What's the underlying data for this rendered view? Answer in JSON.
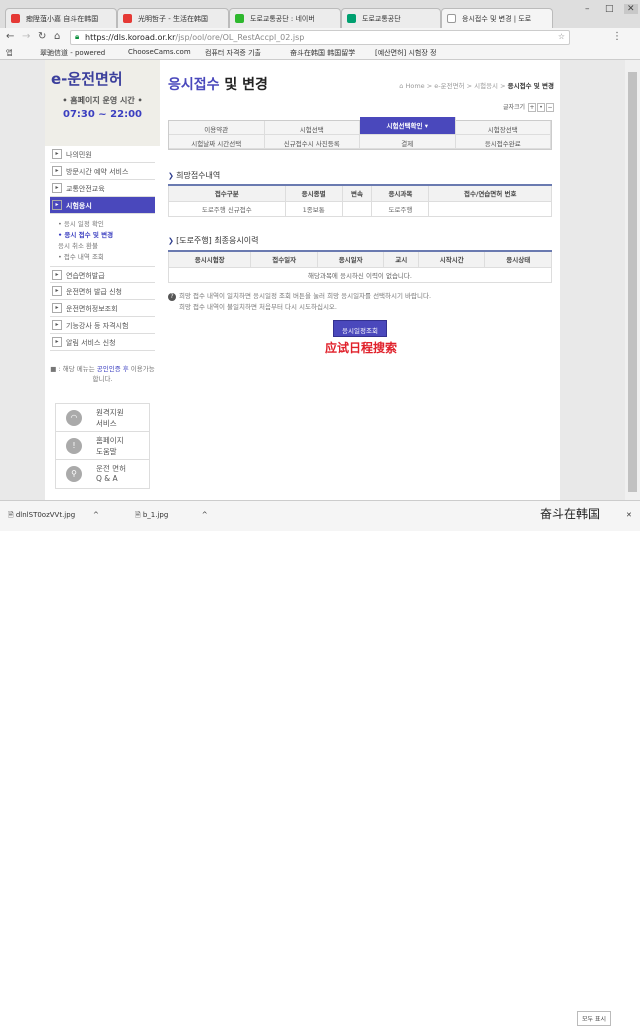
{
  "browser": {
    "tabs": [
      {
        "label": "瘛陞菹小嘉 自斗在韩国",
        "color": "#e53935"
      },
      {
        "label": "光明哲子 - 生活在韩国",
        "color": "#e53935"
      },
      {
        "label": "도로교통공단 : 네이버",
        "color": "#2eb82e"
      },
      {
        "label": "도로교통공단",
        "color": "#00a070"
      },
      {
        "label": "응시접수 및 변경 | 도로",
        "color": "#999999"
      }
    ],
    "url_host": "https://dls.koroad.or.kr",
    "url_path": "/jsp/ool/ore/OL_RestAccpl_02.jsp",
    "bookmarks": [
      "앱",
      "翠驰信道 - powered",
      "ChooseCams.com",
      "컴퓨터 자격증 기출",
      "奋斗在韩国 韩国留学",
      "[예산면허] 시험장 정"
    ]
  },
  "sidebar": {
    "logo": "e-운전면허",
    "hours_label": "• 홈페이지 운영 시간 •",
    "hours": "07:30 ~ 22:00",
    "menu_top": [
      "나의민원",
      "방문시간 예약 서비스",
      "교통안전교육",
      "시험응시"
    ],
    "sub": [
      "• 응시 일정 확인",
      "• 응시 접수 및 변경",
      "응시 취소 환불",
      "• 접수 내역 조회"
    ],
    "menu_bottom": [
      "연습면허발급",
      "운전면허 발급 신청",
      "운전면허정보조회",
      "기능강사 등 자격시험",
      "알림 서비스 신청"
    ],
    "note_pre": "■ : 해당 메뉴는 ",
    "note_link": "공인인증 후",
    "note_post": " 이용가능합니다.",
    "help": [
      [
        "원격지원",
        "서비스"
      ],
      [
        "홈페이지",
        "도움말"
      ],
      [
        "운전 면허",
        "Q & A"
      ]
    ]
  },
  "main": {
    "title_a": "응시접수",
    "title_b": " 및 변경",
    "crumb": "⌂ Home > e-운전면허 > 시험응시 > ",
    "crumb_cur": "응시접수 및 변경",
    "font_size": "글자크기",
    "font_btns": [
      "+",
      "•",
      "−"
    ],
    "steps": [
      "이용약관",
      "시험선택",
      "시험선택확인 ▾",
      "시험장선택",
      "시험날짜 시간선택",
      "신규접수시 사진등록",
      "결제",
      "응시접수완료"
    ],
    "sec1": "희망접수내역",
    "t1_head": [
      "접수구분",
      "응시종별",
      "변속",
      "응시과목",
      "접수/연습면허 번호"
    ],
    "t1_row": [
      "도로주행 신규접수",
      "1종보통",
      "",
      "도로주행",
      ""
    ],
    "sec2": "[도로주행] 최종응시이력",
    "t2_head": [
      "응시시험장",
      "접수일자",
      "응시일자",
      "교시",
      "시작시간",
      "응시상태"
    ],
    "t2_empty": "해당과목에 응시하신 이력이 없습니다.",
    "info1": "희망 접수 내역이 일치하면 응시일정 조회 버튼을 눌러 희망 응시일자를 선택하시기 바랍니다.",
    "info2": "희망 접수 내역이 불일치하면 처음부터 다시 시도하십시오.",
    "button": "응시일정조회",
    "annotation": "应试日程搜索"
  },
  "downloads": [
    "dlnlST0ozVVt.jpg",
    "b_1.jpg"
  ],
  "show_all": "모두 표시",
  "watermark": "奋斗在韩国"
}
